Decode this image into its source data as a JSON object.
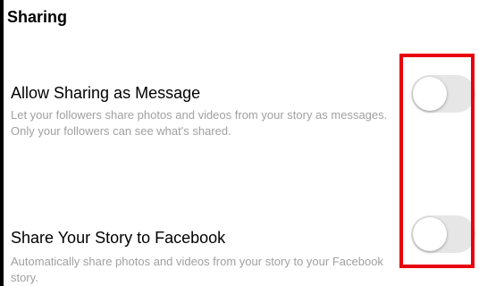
{
  "section": {
    "title": "Sharing"
  },
  "settings": [
    {
      "title": "Allow Sharing as Message",
      "description": "Let your followers share photos and videos from your story as messages. Only your followers can see what's shared.",
      "enabled": false
    },
    {
      "title": "Share Your Story to Facebook",
      "description": "Automatically share photos and videos from your story to your Facebook story.",
      "enabled": false
    }
  ],
  "colors": {
    "highlight": "#e8000d",
    "toggle_off_track": "#e6e6e6",
    "description_text": "#a0a0a0"
  }
}
